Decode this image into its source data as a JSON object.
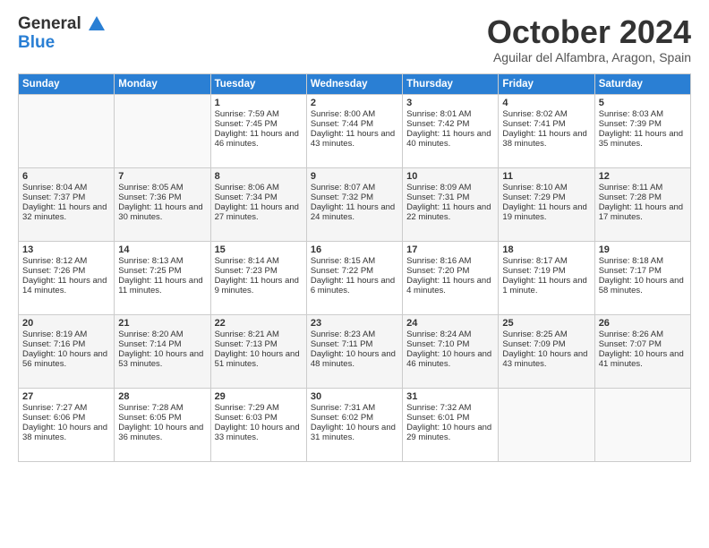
{
  "header": {
    "logo_line1": "General",
    "logo_line2": "Blue",
    "month": "October 2024",
    "location": "Aguilar del Alfambra, Aragon, Spain"
  },
  "days_of_week": [
    "Sunday",
    "Monday",
    "Tuesday",
    "Wednesday",
    "Thursday",
    "Friday",
    "Saturday"
  ],
  "weeks": [
    [
      {
        "day": "",
        "sunrise": "",
        "sunset": "",
        "daylight": ""
      },
      {
        "day": "",
        "sunrise": "",
        "sunset": "",
        "daylight": ""
      },
      {
        "day": "1",
        "sunrise": "Sunrise: 7:59 AM",
        "sunset": "Sunset: 7:45 PM",
        "daylight": "Daylight: 11 hours and 46 minutes."
      },
      {
        "day": "2",
        "sunrise": "Sunrise: 8:00 AM",
        "sunset": "Sunset: 7:44 PM",
        "daylight": "Daylight: 11 hours and 43 minutes."
      },
      {
        "day": "3",
        "sunrise": "Sunrise: 8:01 AM",
        "sunset": "Sunset: 7:42 PM",
        "daylight": "Daylight: 11 hours and 40 minutes."
      },
      {
        "day": "4",
        "sunrise": "Sunrise: 8:02 AM",
        "sunset": "Sunset: 7:41 PM",
        "daylight": "Daylight: 11 hours and 38 minutes."
      },
      {
        "day": "5",
        "sunrise": "Sunrise: 8:03 AM",
        "sunset": "Sunset: 7:39 PM",
        "daylight": "Daylight: 11 hours and 35 minutes."
      }
    ],
    [
      {
        "day": "6",
        "sunrise": "Sunrise: 8:04 AM",
        "sunset": "Sunset: 7:37 PM",
        "daylight": "Daylight: 11 hours and 32 minutes."
      },
      {
        "day": "7",
        "sunrise": "Sunrise: 8:05 AM",
        "sunset": "Sunset: 7:36 PM",
        "daylight": "Daylight: 11 hours and 30 minutes."
      },
      {
        "day": "8",
        "sunrise": "Sunrise: 8:06 AM",
        "sunset": "Sunset: 7:34 PM",
        "daylight": "Daylight: 11 hours and 27 minutes."
      },
      {
        "day": "9",
        "sunrise": "Sunrise: 8:07 AM",
        "sunset": "Sunset: 7:32 PM",
        "daylight": "Daylight: 11 hours and 24 minutes."
      },
      {
        "day": "10",
        "sunrise": "Sunrise: 8:09 AM",
        "sunset": "Sunset: 7:31 PM",
        "daylight": "Daylight: 11 hours and 22 minutes."
      },
      {
        "day": "11",
        "sunrise": "Sunrise: 8:10 AM",
        "sunset": "Sunset: 7:29 PM",
        "daylight": "Daylight: 11 hours and 19 minutes."
      },
      {
        "day": "12",
        "sunrise": "Sunrise: 8:11 AM",
        "sunset": "Sunset: 7:28 PM",
        "daylight": "Daylight: 11 hours and 17 minutes."
      }
    ],
    [
      {
        "day": "13",
        "sunrise": "Sunrise: 8:12 AM",
        "sunset": "Sunset: 7:26 PM",
        "daylight": "Daylight: 11 hours and 14 minutes."
      },
      {
        "day": "14",
        "sunrise": "Sunrise: 8:13 AM",
        "sunset": "Sunset: 7:25 PM",
        "daylight": "Daylight: 11 hours and 11 minutes."
      },
      {
        "day": "15",
        "sunrise": "Sunrise: 8:14 AM",
        "sunset": "Sunset: 7:23 PM",
        "daylight": "Daylight: 11 hours and 9 minutes."
      },
      {
        "day": "16",
        "sunrise": "Sunrise: 8:15 AM",
        "sunset": "Sunset: 7:22 PM",
        "daylight": "Daylight: 11 hours and 6 minutes."
      },
      {
        "day": "17",
        "sunrise": "Sunrise: 8:16 AM",
        "sunset": "Sunset: 7:20 PM",
        "daylight": "Daylight: 11 hours and 4 minutes."
      },
      {
        "day": "18",
        "sunrise": "Sunrise: 8:17 AM",
        "sunset": "Sunset: 7:19 PM",
        "daylight": "Daylight: 11 hours and 1 minute."
      },
      {
        "day": "19",
        "sunrise": "Sunrise: 8:18 AM",
        "sunset": "Sunset: 7:17 PM",
        "daylight": "Daylight: 10 hours and 58 minutes."
      }
    ],
    [
      {
        "day": "20",
        "sunrise": "Sunrise: 8:19 AM",
        "sunset": "Sunset: 7:16 PM",
        "daylight": "Daylight: 10 hours and 56 minutes."
      },
      {
        "day": "21",
        "sunrise": "Sunrise: 8:20 AM",
        "sunset": "Sunset: 7:14 PM",
        "daylight": "Daylight: 10 hours and 53 minutes."
      },
      {
        "day": "22",
        "sunrise": "Sunrise: 8:21 AM",
        "sunset": "Sunset: 7:13 PM",
        "daylight": "Daylight: 10 hours and 51 minutes."
      },
      {
        "day": "23",
        "sunrise": "Sunrise: 8:23 AM",
        "sunset": "Sunset: 7:11 PM",
        "daylight": "Daylight: 10 hours and 48 minutes."
      },
      {
        "day": "24",
        "sunrise": "Sunrise: 8:24 AM",
        "sunset": "Sunset: 7:10 PM",
        "daylight": "Daylight: 10 hours and 46 minutes."
      },
      {
        "day": "25",
        "sunrise": "Sunrise: 8:25 AM",
        "sunset": "Sunset: 7:09 PM",
        "daylight": "Daylight: 10 hours and 43 minutes."
      },
      {
        "day": "26",
        "sunrise": "Sunrise: 8:26 AM",
        "sunset": "Sunset: 7:07 PM",
        "daylight": "Daylight: 10 hours and 41 minutes."
      }
    ],
    [
      {
        "day": "27",
        "sunrise": "Sunrise: 7:27 AM",
        "sunset": "Sunset: 6:06 PM",
        "daylight": "Daylight: 10 hours and 38 minutes."
      },
      {
        "day": "28",
        "sunrise": "Sunrise: 7:28 AM",
        "sunset": "Sunset: 6:05 PM",
        "daylight": "Daylight: 10 hours and 36 minutes."
      },
      {
        "day": "29",
        "sunrise": "Sunrise: 7:29 AM",
        "sunset": "Sunset: 6:03 PM",
        "daylight": "Daylight: 10 hours and 33 minutes."
      },
      {
        "day": "30",
        "sunrise": "Sunrise: 7:31 AM",
        "sunset": "Sunset: 6:02 PM",
        "daylight": "Daylight: 10 hours and 31 minutes."
      },
      {
        "day": "31",
        "sunrise": "Sunrise: 7:32 AM",
        "sunset": "Sunset: 6:01 PM",
        "daylight": "Daylight: 10 hours and 29 minutes."
      },
      {
        "day": "",
        "sunrise": "",
        "sunset": "",
        "daylight": ""
      },
      {
        "day": "",
        "sunrise": "",
        "sunset": "",
        "daylight": ""
      }
    ]
  ]
}
